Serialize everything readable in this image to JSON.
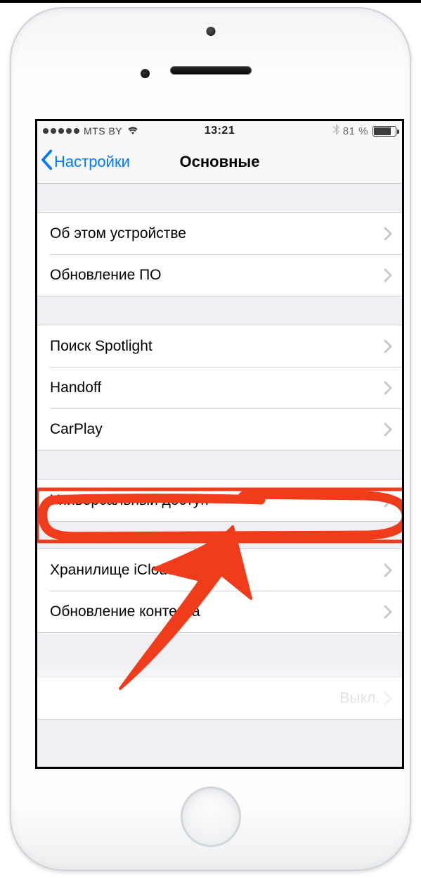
{
  "status": {
    "carrier": "MTS BY",
    "time": "13:21",
    "battery_pct_label": "81 %",
    "battery_fill_pct": 81
  },
  "nav": {
    "back_label": "Настройки",
    "title": "Основные"
  },
  "groups": [
    {
      "cells": [
        {
          "label": "Об этом устройстве"
        },
        {
          "label": "Обновление ПО"
        }
      ]
    },
    {
      "cells": [
        {
          "label": "Поиск Spotlight"
        },
        {
          "label": "Handoff"
        },
        {
          "label": "CarPlay"
        }
      ]
    },
    {
      "cells": [
        {
          "label": "Универсальный доступ"
        }
      ]
    },
    {
      "cells": [
        {
          "label": "Хранилище iCloud"
        },
        {
          "label": "Обновление контента"
        }
      ]
    },
    {
      "cells": [
        {
          "label": "",
          "value": "Выкл."
        }
      ]
    }
  ],
  "annotation": {
    "stroke": "#f13c1c",
    "highlighted_item": "Универсальный доступ"
  }
}
